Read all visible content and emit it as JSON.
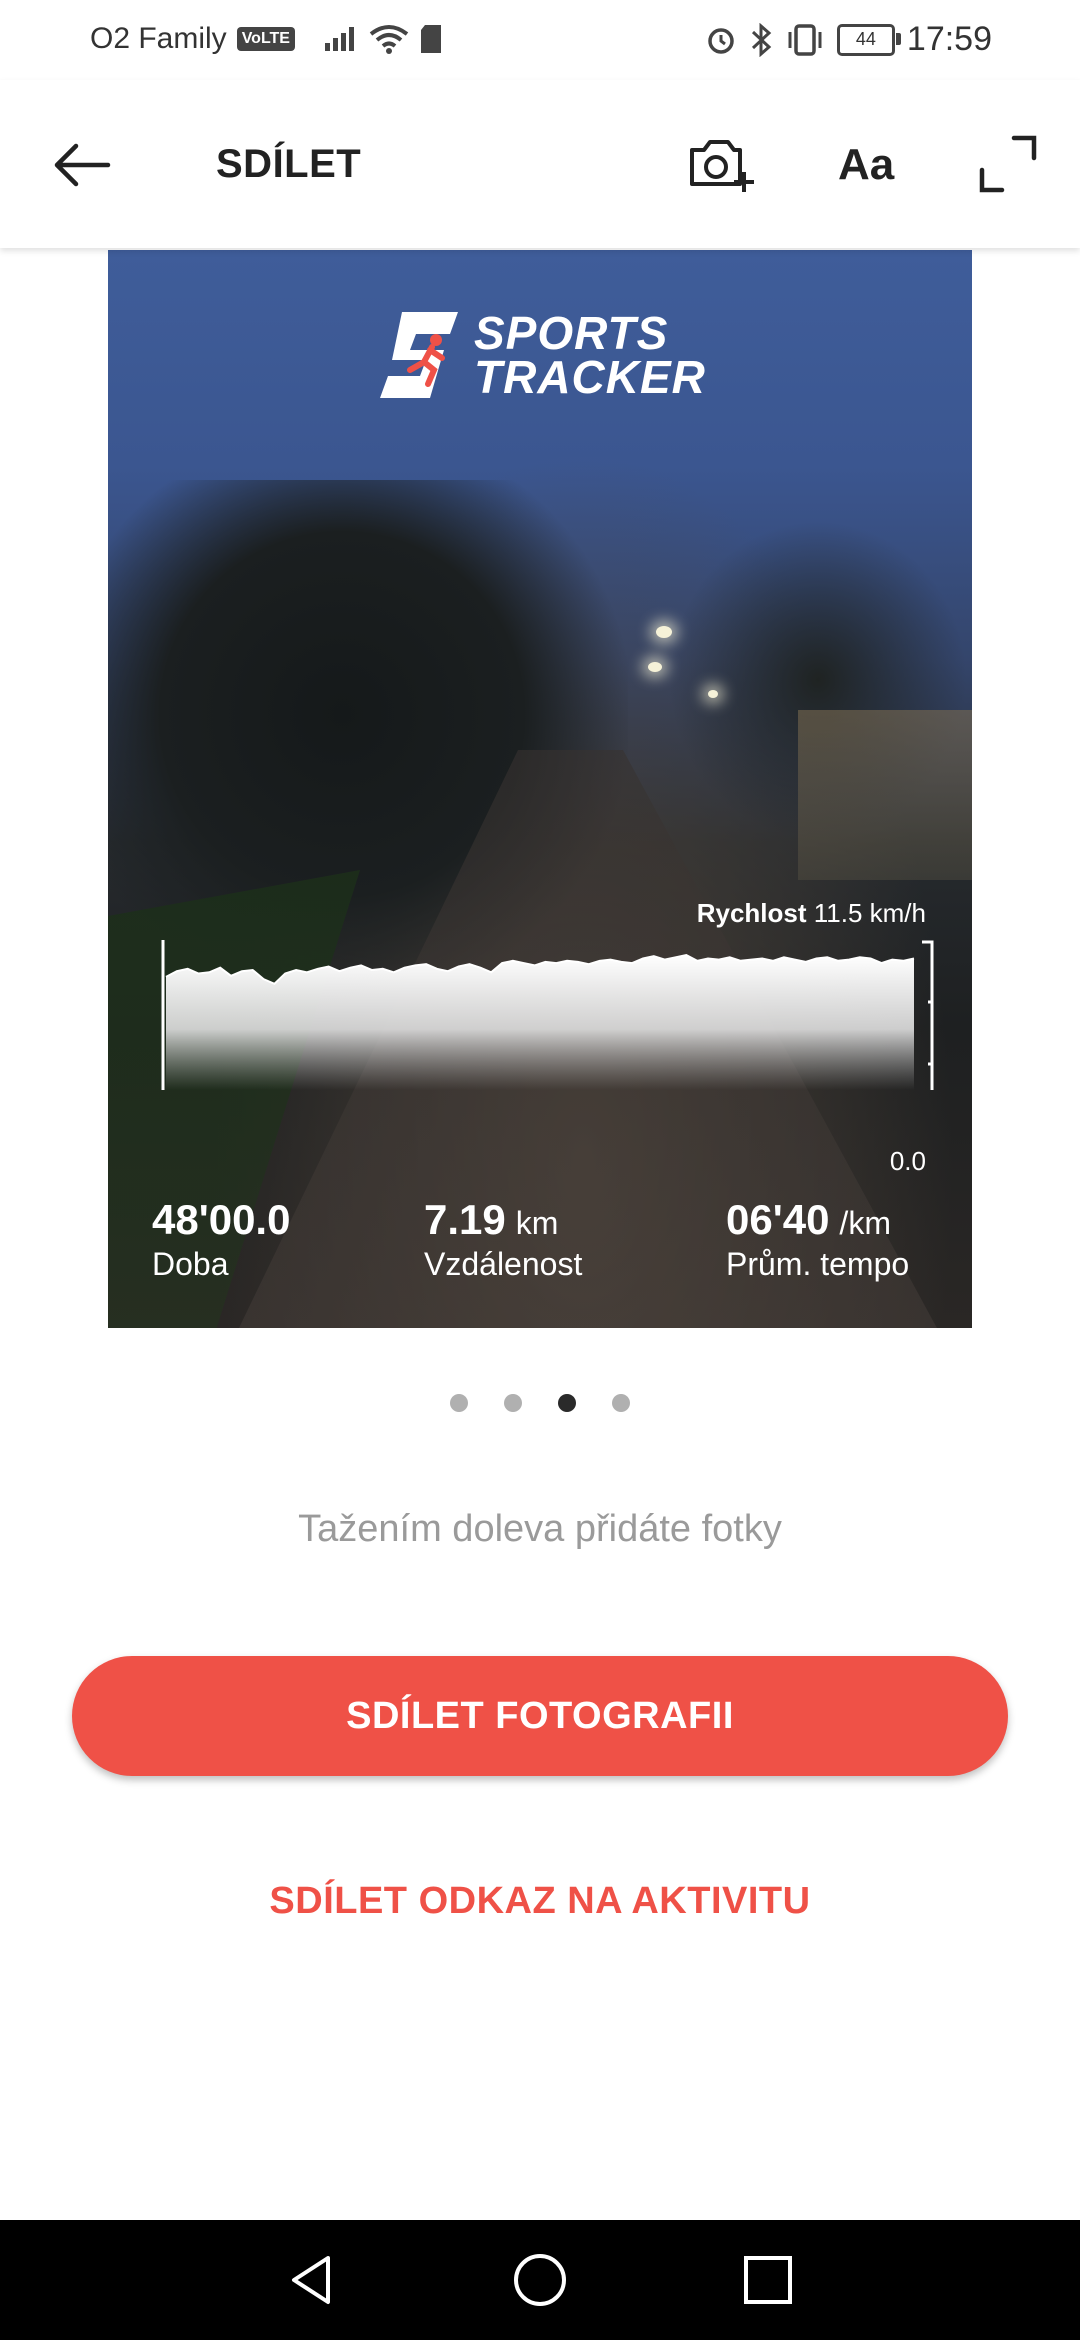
{
  "status_bar": {
    "carrier": "O2 Family",
    "volte": "VoLTE",
    "battery": "44",
    "time": "17:59"
  },
  "header": {
    "title": "SDÍLET",
    "text_style_label": "Aa",
    "icons": [
      "arrow-back-icon",
      "add-photo-icon",
      "fullscreen-icon"
    ]
  },
  "share_card": {
    "brand": [
      "SPORTS",
      "TRACKER"
    ],
    "speed_label": "Rychlost",
    "speed_value": "11.5 km/h",
    "axis_min_label": "0.0",
    "stats": [
      {
        "value": "48'00.0",
        "unit": "",
        "label": "Doba"
      },
      {
        "value": "7.19",
        "unit": "km",
        "label": "Vzdálenost"
      },
      {
        "value": "06'40",
        "unit": "/km",
        "label": "Prům. tempo"
      }
    ]
  },
  "chart_data": {
    "type": "area",
    "title": "",
    "ylabel": "Rychlost",
    "ylim": [
      0.0,
      13.0
    ],
    "series": [
      {
        "name": "Rychlost",
        "values": [
          9.8,
          10.3,
          10.5,
          10.1,
          10.2,
          10.6,
          9.9,
          10.3,
          10.4,
          9.6,
          9.2,
          10.1,
          10.4,
          10.2,
          10.5,
          10.7,
          10.3,
          10.6,
          10.8,
          10.4,
          10.5,
          10.2,
          10.6,
          10.8,
          10.9,
          10.5,
          10.3,
          10.7,
          10.9,
          10.6,
          10.2,
          11.0,
          11.2,
          11.0,
          10.8,
          11.1,
          11.0,
          11.2,
          11.1,
          10.9,
          11.2,
          11.3,
          11.1,
          11.0,
          11.4,
          11.6,
          11.3,
          11.5,
          11.7,
          11.2,
          11.4,
          11.3,
          11.5,
          11.2,
          11.3,
          11.4,
          11.2,
          11.5,
          11.3,
          11.1,
          11.4,
          11.5,
          11.2,
          11.3,
          11.5,
          11.4,
          11.0,
          11.3,
          11.2,
          11.4
        ]
      }
    ]
  },
  "pager": {
    "count": 4,
    "active_index": 2
  },
  "hint": "Tažením doleva přidáte fotky",
  "actions": {
    "share_photo": "SDÍLET FOTOGRAFII",
    "share_link": "SDÍLET ODKAZ NA AKTIVITU"
  },
  "nav": {
    "icons": [
      "nav-back-icon",
      "nav-home-icon",
      "nav-recents-icon"
    ]
  },
  "colors": {
    "accent": "#ef5147",
    "text_dark": "#222222",
    "hint": "#9a9a9a"
  }
}
